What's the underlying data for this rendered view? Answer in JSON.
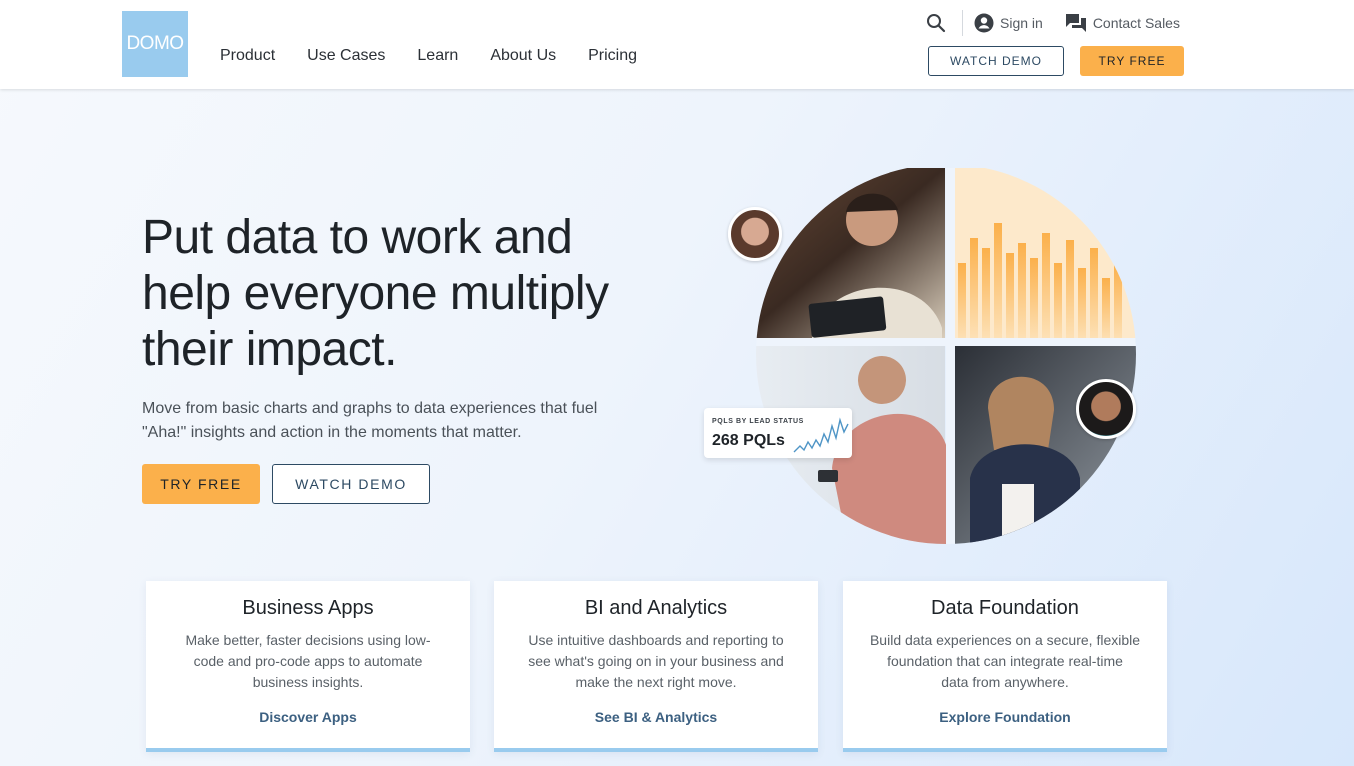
{
  "header": {
    "logo_text": "DOMO",
    "nav": [
      "Product",
      "Use Cases",
      "Learn",
      "About Us",
      "Pricing"
    ],
    "sign_in": "Sign in",
    "contact_sales": "Contact Sales",
    "watch_demo": "WATCH DEMO",
    "try_free": "TRY FREE"
  },
  "hero": {
    "title_lines": [
      "Put data to work and",
      "help everyone multiply",
      "their impact."
    ],
    "subtitle_lines": [
      "Move from basic charts and graphs to data experiences that fuel",
      "\"Aha!\" insights and action in the moments that matter."
    ],
    "try_free": "TRY FREE",
    "watch_demo": "WATCH DEMO",
    "stat_card": {
      "label": "PQLS BY LEAD STATUS",
      "value": "268 PQLs"
    }
  },
  "cards": [
    {
      "title": "Business Apps",
      "desc_lines": [
        "Make better, faster decisions using low-",
        "code and pro-code apps to automate",
        "business insights."
      ],
      "link": "Discover Apps"
    },
    {
      "title": "BI and Analytics",
      "desc_lines": [
        "Use intuitive dashboards and reporting to",
        "see what's going on in your business and",
        "make the next right move."
      ],
      "link": "See BI & Analytics"
    },
    {
      "title": "Data Foundation",
      "desc_lines": [
        "Build data experiences on a secure, flexible",
        "foundation that can integrate real-time",
        "data from anywhere."
      ],
      "link": "Explore Foundation"
    }
  ],
  "colors": {
    "brand": "#99cbee",
    "accent": "#fbb04b",
    "navy": "#2d4a63"
  },
  "icons": [
    "search-icon",
    "account-icon",
    "chat-icon"
  ]
}
